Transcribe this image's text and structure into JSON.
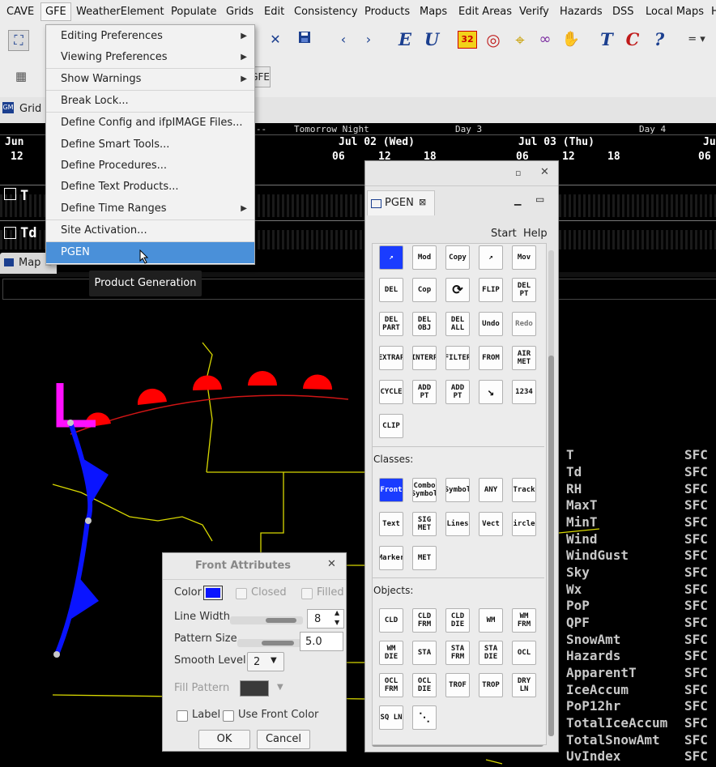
{
  "menubar": [
    "CAVE",
    "GFE",
    "WeatherElement",
    "Populate",
    "Grids",
    "Edit",
    "Consistency",
    "Products",
    "Maps",
    "Edit Areas",
    "Verify",
    "Hazards",
    "DSS",
    "Local Maps",
    "H"
  ],
  "gfe_menu": {
    "items": [
      {
        "label": "Editing Preferences",
        "submenu": true
      },
      {
        "label": "Viewing Preferences",
        "submenu": true
      },
      {
        "label": "Show Warnings",
        "submenu": true
      },
      {
        "label": "Break Lock...",
        "submenu": false
      },
      {
        "label": "Define Config and ifpIMAGE Files...",
        "submenu": false
      },
      {
        "label": "Define Smart Tools...",
        "submenu": false
      },
      {
        "label": "Define Procedures...",
        "submenu": false
      },
      {
        "label": "Define Text Products...",
        "submenu": false
      },
      {
        "label": "Define Time Ranges",
        "submenu": true
      },
      {
        "label": "Site Activation...",
        "submenu": false
      },
      {
        "label": "PGEN",
        "submenu": false,
        "selected": true
      }
    ],
    "tooltip": "Product Generation"
  },
  "toolbar": {
    "badge": "32",
    "gfe_label": "GFE"
  },
  "grid_tab": {
    "label": "Grid"
  },
  "timescale": {
    "top_row": [
      {
        "text": "ow---"
      },
      {
        "text": "Tomorrow Night"
      },
      {
        "text": "Day 3"
      },
      {
        "text": "Day 4"
      }
    ],
    "dates": [
      "Jun",
      "Jul 02 (Wed)",
      "Jul 03 (Thu)",
      "Ju"
    ],
    "hours": [
      "12",
      "06",
      "12",
      "18",
      "06",
      "12",
      "18",
      "06"
    ],
    "rows": [
      "T",
      "Td"
    ]
  },
  "map_tab": {
    "label": "Map"
  },
  "pgen": {
    "title": "PGEN",
    "start": "Start",
    "help": "Help",
    "actions": [
      "Mod",
      "Copy",
      "Mov",
      "DEL",
      "Cop",
      "",
      "FLIP",
      "DEL PT",
      "DEL PART",
      "DEL OBJ",
      "DEL ALL",
      "Undo",
      "Redo",
      "EXTRAP",
      "INTERP",
      "FILTER",
      "FROM",
      "AIR MET",
      "CYCLE",
      "ADD PT",
      "ADD PT",
      "",
      "1234",
      "CLIP"
    ],
    "classes_label": "Classes:",
    "classes": [
      "Front",
      "Combo Symbol",
      "Symbol",
      "ANY",
      "Track",
      "Text",
      "SIG MET",
      "Lines",
      "Vect",
      "Circles",
      "Marker",
      "MET"
    ],
    "objects_label": "Objects:",
    "objects": [
      "CLD",
      "CLD FRM",
      "CLD DIE",
      "WM",
      "WM FRM",
      "WM DIE",
      "STA",
      "STA FRM",
      "STA DIE",
      "OCL",
      "OCL FRM",
      "OCL DIE",
      "TROF",
      "TROP",
      "DRY LN",
      "SQ LN",
      ""
    ]
  },
  "front_attributes": {
    "title": "Front Attributes",
    "color_label": "Color",
    "color_value": "#0a14ff",
    "closed_label": "Closed",
    "filled_label": "Filled",
    "line_width_label": "Line Width",
    "line_width_value": "8",
    "pattern_size_label": "Pattern Size",
    "pattern_size_value": "5.0",
    "smooth_level_label": "Smooth Level",
    "smooth_level_value": "2",
    "fill_pattern_label": "Fill Pattern",
    "label_label": "Label",
    "use_front_color_label": "Use Front Color",
    "ok": "OK",
    "cancel": "Cancel"
  },
  "weather_elements": [
    {
      "name": "T",
      "level": "SFC"
    },
    {
      "name": "Td",
      "level": "SFC"
    },
    {
      "name": "RH",
      "level": "SFC"
    },
    {
      "name": "MaxT",
      "level": "SFC"
    },
    {
      "name": "MinT",
      "level": "SFC"
    },
    {
      "name": "Wind",
      "level": "SFC"
    },
    {
      "name": "WindGust",
      "level": "SFC"
    },
    {
      "name": "Sky",
      "level": "SFC"
    },
    {
      "name": "Wx",
      "level": "SFC"
    },
    {
      "name": "PoP",
      "level": "SFC"
    },
    {
      "name": "QPF",
      "level": "SFC"
    },
    {
      "name": "SnowAmt",
      "level": "SFC"
    },
    {
      "name": "Hazards",
      "level": "SFC"
    },
    {
      "name": "ApparentT",
      "level": "SFC"
    },
    {
      "name": "IceAccum",
      "level": "SFC"
    },
    {
      "name": "PoP12hr",
      "level": "SFC"
    },
    {
      "name": "TotalIceAccum",
      "level": "SFC"
    },
    {
      "name": "TotalSnowAmt",
      "level": "SFC"
    },
    {
      "name": "UvIndex",
      "level": "SFC"
    }
  ]
}
